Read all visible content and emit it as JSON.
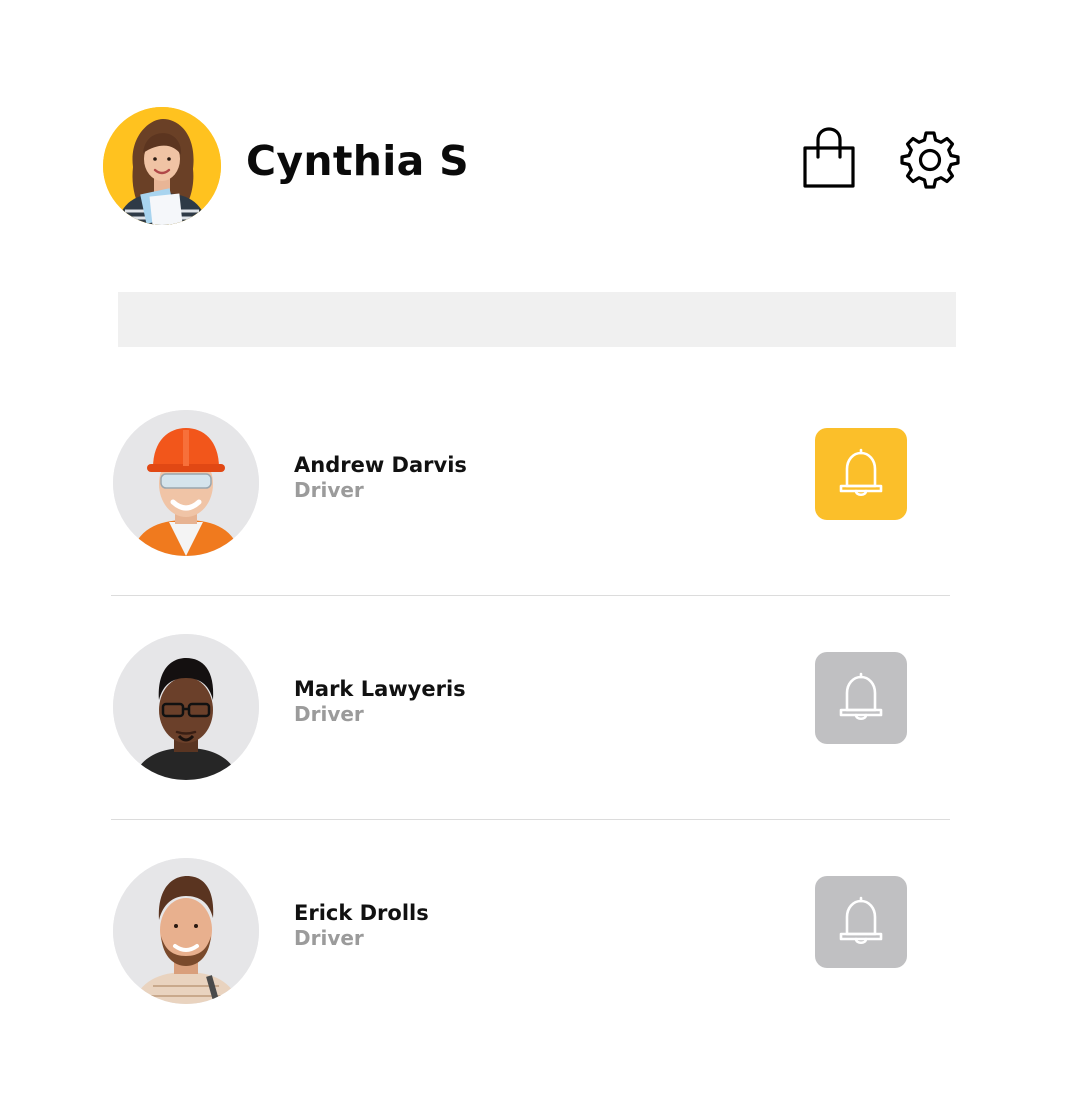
{
  "header": {
    "user_name": "Cynthia S",
    "avatar_bg": "#ffc21f",
    "icons": [
      "shopping-bag-icon",
      "gear-icon"
    ]
  },
  "search": {
    "placeholder": "",
    "value": ""
  },
  "drivers": [
    {
      "name": "Andrew Darvis",
      "role": "Driver",
      "notification_active": true
    },
    {
      "name": "Mark Lawyeris",
      "role": "Driver",
      "notification_active": false
    },
    {
      "name": "Erick Drolls",
      "role": "Driver",
      "notification_active": false
    }
  ],
  "colors": {
    "accent": "#fbbf2a",
    "inactive": "#c0c0c2",
    "search_bg": "#f0f0f0",
    "role_text": "#9b9b9b",
    "avatar_bg": "#e6e6e8"
  }
}
